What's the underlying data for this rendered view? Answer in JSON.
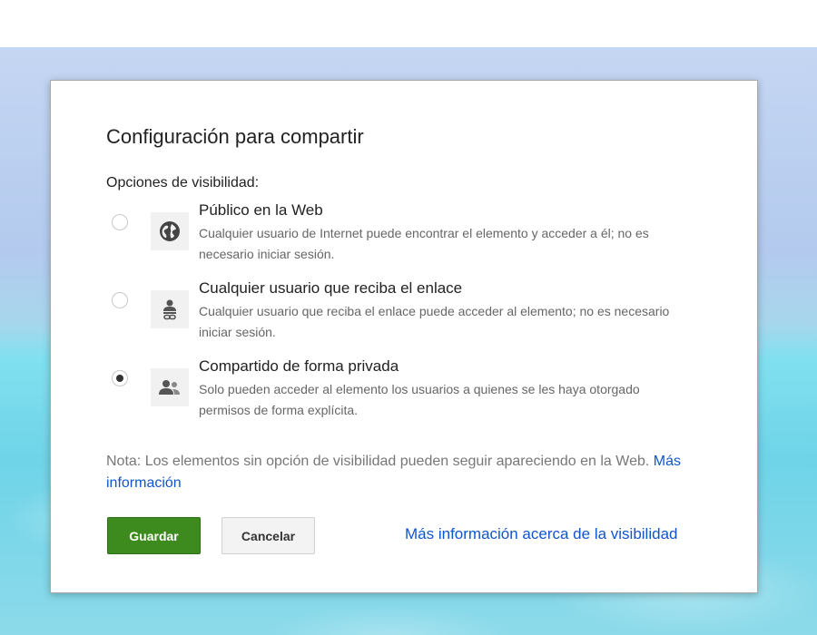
{
  "dialog": {
    "title": "Configuración para compartir",
    "section_label": "Opciones de visibilidad:",
    "options": [
      {
        "icon": "globe-icon",
        "title": "Público en la Web",
        "description": "Cualquier usuario de Internet puede encontrar el elemento y acceder a él; no es necesario iniciar sesión.",
        "selected": false
      },
      {
        "icon": "person-link-icon",
        "title": "Cualquier usuario que reciba el enlace",
        "description": "Cualquier usuario que reciba el enlace puede acceder al elemento; no es necesario iniciar sesión.",
        "selected": false
      },
      {
        "icon": "people-icon",
        "title": "Compartido de forma privada",
        "description": "Solo pueden acceder al elemento los usuarios a quienes se les haya otorgado permisos de forma explícita.",
        "selected": true
      }
    ],
    "note_text": "Nota: Los elementos sin opción de visibilidad pueden seguir apareciendo en la Web.",
    "note_link": "Más información",
    "save_label": "Guardar",
    "cancel_label": "Cancelar",
    "help_link": "Más información acerca de la visibilidad"
  },
  "colors": {
    "save_button": "#3d8b1e",
    "link": "#1155cc"
  }
}
